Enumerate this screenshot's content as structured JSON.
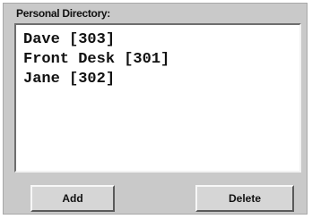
{
  "directory": {
    "title": "Personal Directory:",
    "entries": [
      "Dave [303]",
      "Front Desk [301]",
      "Jane [302]"
    ]
  },
  "buttons": {
    "add_label": "Add",
    "delete_label": "Delete"
  }
}
